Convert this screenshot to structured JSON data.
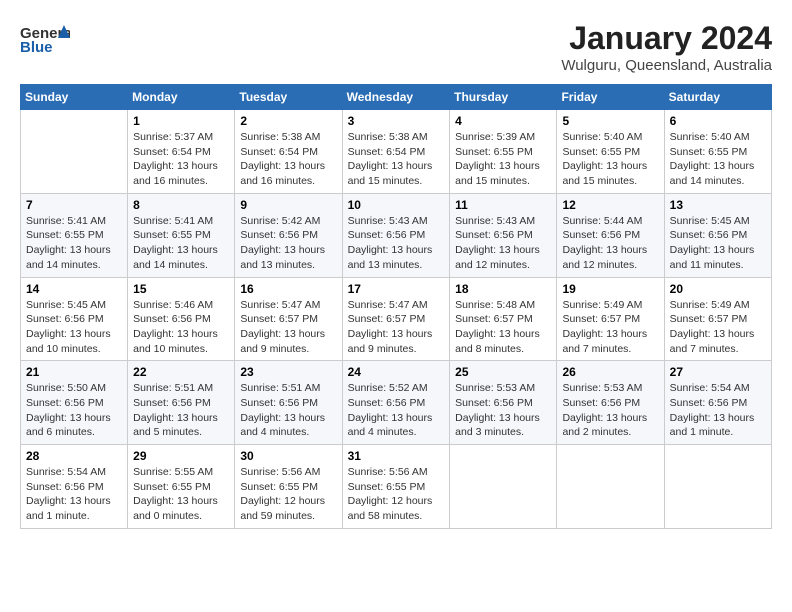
{
  "header": {
    "logo_general": "General",
    "logo_blue": "Blue",
    "month": "January 2024",
    "location": "Wulguru, Queensland, Australia"
  },
  "weekdays": [
    "Sunday",
    "Monday",
    "Tuesday",
    "Wednesday",
    "Thursday",
    "Friday",
    "Saturday"
  ],
  "weeks": [
    [
      {
        "day": "",
        "info": ""
      },
      {
        "day": "1",
        "info": "Sunrise: 5:37 AM\nSunset: 6:54 PM\nDaylight: 13 hours\nand 16 minutes."
      },
      {
        "day": "2",
        "info": "Sunrise: 5:38 AM\nSunset: 6:54 PM\nDaylight: 13 hours\nand 16 minutes."
      },
      {
        "day": "3",
        "info": "Sunrise: 5:38 AM\nSunset: 6:54 PM\nDaylight: 13 hours\nand 15 minutes."
      },
      {
        "day": "4",
        "info": "Sunrise: 5:39 AM\nSunset: 6:55 PM\nDaylight: 13 hours\nand 15 minutes."
      },
      {
        "day": "5",
        "info": "Sunrise: 5:40 AM\nSunset: 6:55 PM\nDaylight: 13 hours\nand 15 minutes."
      },
      {
        "day": "6",
        "info": "Sunrise: 5:40 AM\nSunset: 6:55 PM\nDaylight: 13 hours\nand 14 minutes."
      }
    ],
    [
      {
        "day": "7",
        "info": "Sunrise: 5:41 AM\nSunset: 6:55 PM\nDaylight: 13 hours\nand 14 minutes."
      },
      {
        "day": "8",
        "info": "Sunrise: 5:41 AM\nSunset: 6:55 PM\nDaylight: 13 hours\nand 14 minutes."
      },
      {
        "day": "9",
        "info": "Sunrise: 5:42 AM\nSunset: 6:56 PM\nDaylight: 13 hours\nand 13 minutes."
      },
      {
        "day": "10",
        "info": "Sunrise: 5:43 AM\nSunset: 6:56 PM\nDaylight: 13 hours\nand 13 minutes."
      },
      {
        "day": "11",
        "info": "Sunrise: 5:43 AM\nSunset: 6:56 PM\nDaylight: 13 hours\nand 12 minutes."
      },
      {
        "day": "12",
        "info": "Sunrise: 5:44 AM\nSunset: 6:56 PM\nDaylight: 13 hours\nand 12 minutes."
      },
      {
        "day": "13",
        "info": "Sunrise: 5:45 AM\nSunset: 6:56 PM\nDaylight: 13 hours\nand 11 minutes."
      }
    ],
    [
      {
        "day": "14",
        "info": "Sunrise: 5:45 AM\nSunset: 6:56 PM\nDaylight: 13 hours\nand 10 minutes."
      },
      {
        "day": "15",
        "info": "Sunrise: 5:46 AM\nSunset: 6:56 PM\nDaylight: 13 hours\nand 10 minutes."
      },
      {
        "day": "16",
        "info": "Sunrise: 5:47 AM\nSunset: 6:57 PM\nDaylight: 13 hours\nand 9 minutes."
      },
      {
        "day": "17",
        "info": "Sunrise: 5:47 AM\nSunset: 6:57 PM\nDaylight: 13 hours\nand 9 minutes."
      },
      {
        "day": "18",
        "info": "Sunrise: 5:48 AM\nSunset: 6:57 PM\nDaylight: 13 hours\nand 8 minutes."
      },
      {
        "day": "19",
        "info": "Sunrise: 5:49 AM\nSunset: 6:57 PM\nDaylight: 13 hours\nand 7 minutes."
      },
      {
        "day": "20",
        "info": "Sunrise: 5:49 AM\nSunset: 6:57 PM\nDaylight: 13 hours\nand 7 minutes."
      }
    ],
    [
      {
        "day": "21",
        "info": "Sunrise: 5:50 AM\nSunset: 6:56 PM\nDaylight: 13 hours\nand 6 minutes."
      },
      {
        "day": "22",
        "info": "Sunrise: 5:51 AM\nSunset: 6:56 PM\nDaylight: 13 hours\nand 5 minutes."
      },
      {
        "day": "23",
        "info": "Sunrise: 5:51 AM\nSunset: 6:56 PM\nDaylight: 13 hours\nand 4 minutes."
      },
      {
        "day": "24",
        "info": "Sunrise: 5:52 AM\nSunset: 6:56 PM\nDaylight: 13 hours\nand 4 minutes."
      },
      {
        "day": "25",
        "info": "Sunrise: 5:53 AM\nSunset: 6:56 PM\nDaylight: 13 hours\nand 3 minutes."
      },
      {
        "day": "26",
        "info": "Sunrise: 5:53 AM\nSunset: 6:56 PM\nDaylight: 13 hours\nand 2 minutes."
      },
      {
        "day": "27",
        "info": "Sunrise: 5:54 AM\nSunset: 6:56 PM\nDaylight: 13 hours\nand 1 minute."
      }
    ],
    [
      {
        "day": "28",
        "info": "Sunrise: 5:54 AM\nSunset: 6:56 PM\nDaylight: 13 hours\nand 1 minute."
      },
      {
        "day": "29",
        "info": "Sunrise: 5:55 AM\nSunset: 6:55 PM\nDaylight: 13 hours\nand 0 minutes."
      },
      {
        "day": "30",
        "info": "Sunrise: 5:56 AM\nSunset: 6:55 PM\nDaylight: 12 hours\nand 59 minutes."
      },
      {
        "day": "31",
        "info": "Sunrise: 5:56 AM\nSunset: 6:55 PM\nDaylight: 12 hours\nand 58 minutes."
      },
      {
        "day": "",
        "info": ""
      },
      {
        "day": "",
        "info": ""
      },
      {
        "day": "",
        "info": ""
      }
    ]
  ]
}
